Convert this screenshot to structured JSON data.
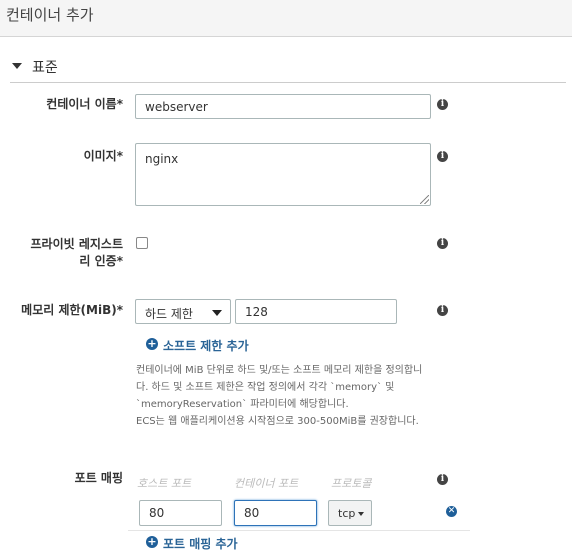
{
  "header": {
    "title": "컨테이너 추가"
  },
  "section": {
    "title": "표준"
  },
  "fields": {
    "container_name": {
      "label": "컨테이너 이름*",
      "value": "webserver"
    },
    "image": {
      "label": "이미지*",
      "value": "nginx"
    },
    "private_registry": {
      "label": "프라이빗 레지스트리 인증*",
      "checked": false
    },
    "memory": {
      "label": "메모리 제한(MiB)*",
      "limit_type": "하드 제한",
      "value": "128",
      "add_soft_limit": "소프트 제한 추가",
      "help": [
        "컨테이너에 MiB 단위로 하드 및/또는 소프트 메모리 제한을 정의합니",
        "다. 하드 및 소프트 제한은 작업 정의에서 각각 `memory` 및",
        "`memoryReservation` 파라미터에 해당합니다.",
        "ECS는 웹 애플리케이션용 시작점으로 300-500MiB를 권장합니다."
      ]
    },
    "port_mapping": {
      "label": "포트 매핑",
      "columns": [
        "호스트 포트",
        "컨테이너 포트",
        "프로토콜"
      ],
      "rows": [
        {
          "host_port": "80",
          "container_port": "80",
          "protocol": "tcp"
        }
      ],
      "add_label": "포트 매핑 추가"
    }
  },
  "icons": {
    "info": "info-icon",
    "add": "plus-circle-icon",
    "remove": "remove-circle-icon",
    "dropdown": "caret-down-icon"
  },
  "colors": {
    "link": "#2a6496",
    "icon_blue": "#1f5f99",
    "focus_border": "#2e73b8"
  }
}
